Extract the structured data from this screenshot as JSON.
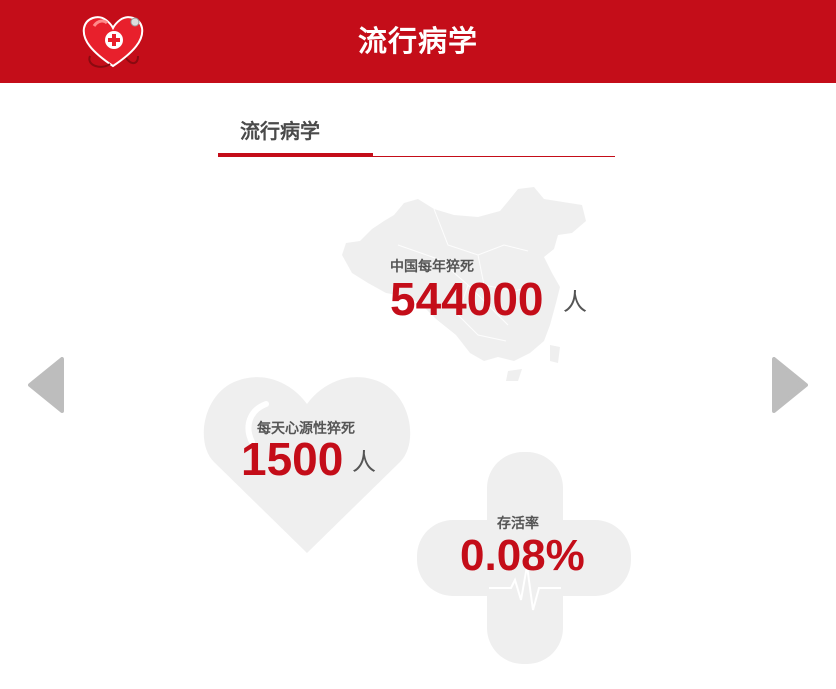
{
  "header": {
    "title": "流行病学"
  },
  "section": {
    "title": "流行病学"
  },
  "stats": {
    "china": {
      "label": "中国每年猝死",
      "value": "544000",
      "unit": "人"
    },
    "daily": {
      "label": "每天心源性猝死",
      "value": "1500",
      "unit": "人"
    },
    "survival": {
      "label": "存活率",
      "value": "0.08%"
    }
  },
  "colors": {
    "brand_red": "#c40d19",
    "graphic_gray": "#efefef",
    "arrow_gray": "#bdbdbd"
  },
  "icons": {
    "logo": "heart-stethoscope-icon",
    "prev": "chevron-left-icon",
    "next": "chevron-right-icon"
  }
}
